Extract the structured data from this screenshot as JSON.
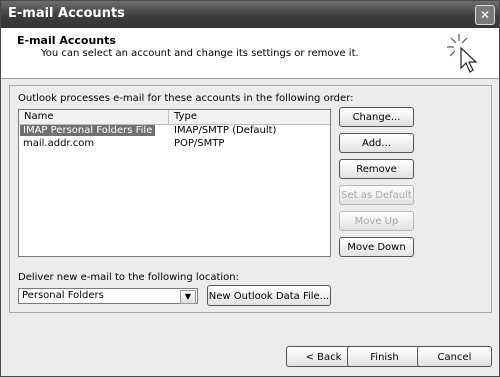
{
  "window": {
    "title": "E-mail Accounts",
    "close_glyph": "✕"
  },
  "header": {
    "title": "E-mail Accounts",
    "subtitle": "You can select an account and change its settings or remove it."
  },
  "accounts": {
    "instruction": "Outlook processes e-mail for these accounts in the following order:",
    "columns": [
      "Name",
      "Type"
    ],
    "rows": [
      {
        "name": "IMAP Personal Folders File",
        "type": "IMAP/SMTP (Default)",
        "selected": true
      },
      {
        "name": "mail.addr.com",
        "type": "POP/SMTP",
        "selected": false
      }
    ]
  },
  "side_buttons": {
    "change": "Change...",
    "add": "Add...",
    "remove": "Remove",
    "set_default": "Set as Default",
    "move_up": "Move Up",
    "move_down": "Move Down"
  },
  "deliver": {
    "label": "Deliver new e-mail to the following location:",
    "selected": "Personal Folders",
    "new_file_button": "New Outlook Data File..."
  },
  "footer": {
    "back": "< Back",
    "finish": "Finish",
    "cancel": "Cancel"
  }
}
